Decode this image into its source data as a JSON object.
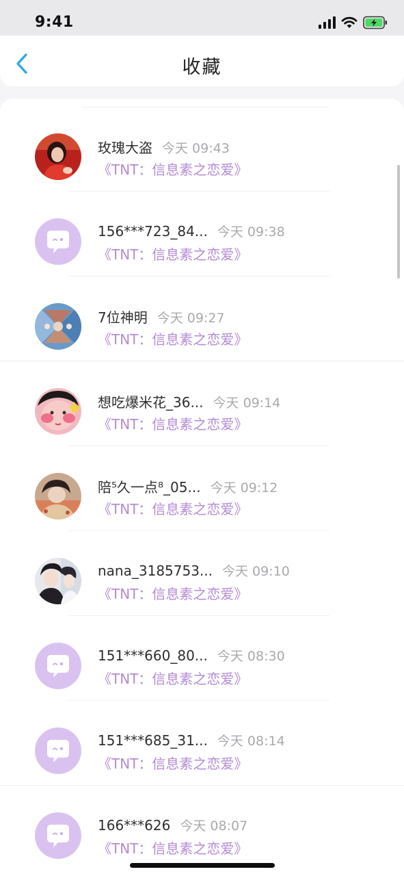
{
  "status_bar": {
    "time": "9:41"
  },
  "nav": {
    "title": "收藏",
    "back_icon": "chevron-left-icon"
  },
  "colors": {
    "accent": "#2ea8e6",
    "book_title": "#b48ad6",
    "timestamp": "#a9a9ad",
    "default_avatar_bg": "#d9c2f0"
  },
  "favorites": [
    {
      "name": "玫瑰大盗",
      "time": "今天 09:43",
      "book": "《TNT：信息素之恋爱》",
      "avatar": "photo-avatar"
    },
    {
      "name": "156***723_84...",
      "time": "今天 09:38",
      "book": "《TNT：信息素之恋爱》",
      "avatar": "default-chat-bubble-avatar"
    },
    {
      "name": "7位神明",
      "time": "今天 09:27",
      "book": "《TNT：信息素之恋爱》",
      "avatar": "photo-avatar"
    },
    {
      "name": "想吃爆米花_36...",
      "time": "今天 09:14",
      "book": "《TNT：信息素之恋爱》",
      "avatar": "photo-avatar"
    },
    {
      "name": "陪⁵久一点⁸_05...",
      "time": "今天 09:12",
      "book": "《TNT：信息素之恋爱》",
      "avatar": "photo-avatar"
    },
    {
      "name": "nana_3185753...",
      "time": "今天 09:10",
      "book": "《TNT：信息素之恋爱》",
      "avatar": "photo-avatar"
    },
    {
      "name": "151***660_80...",
      "time": "今天 08:30",
      "book": "《TNT：信息素之恋爱》",
      "avatar": "default-chat-bubble-avatar"
    },
    {
      "name": "151***685_31...",
      "time": "今天 08:14",
      "book": "《TNT：信息素之恋爱》",
      "avatar": "default-chat-bubble-avatar"
    },
    {
      "name": "166***626",
      "time": "今天 08:07",
      "book": "《TNT：信息素之恋爱》",
      "avatar": "default-chat-bubble-avatar"
    }
  ]
}
